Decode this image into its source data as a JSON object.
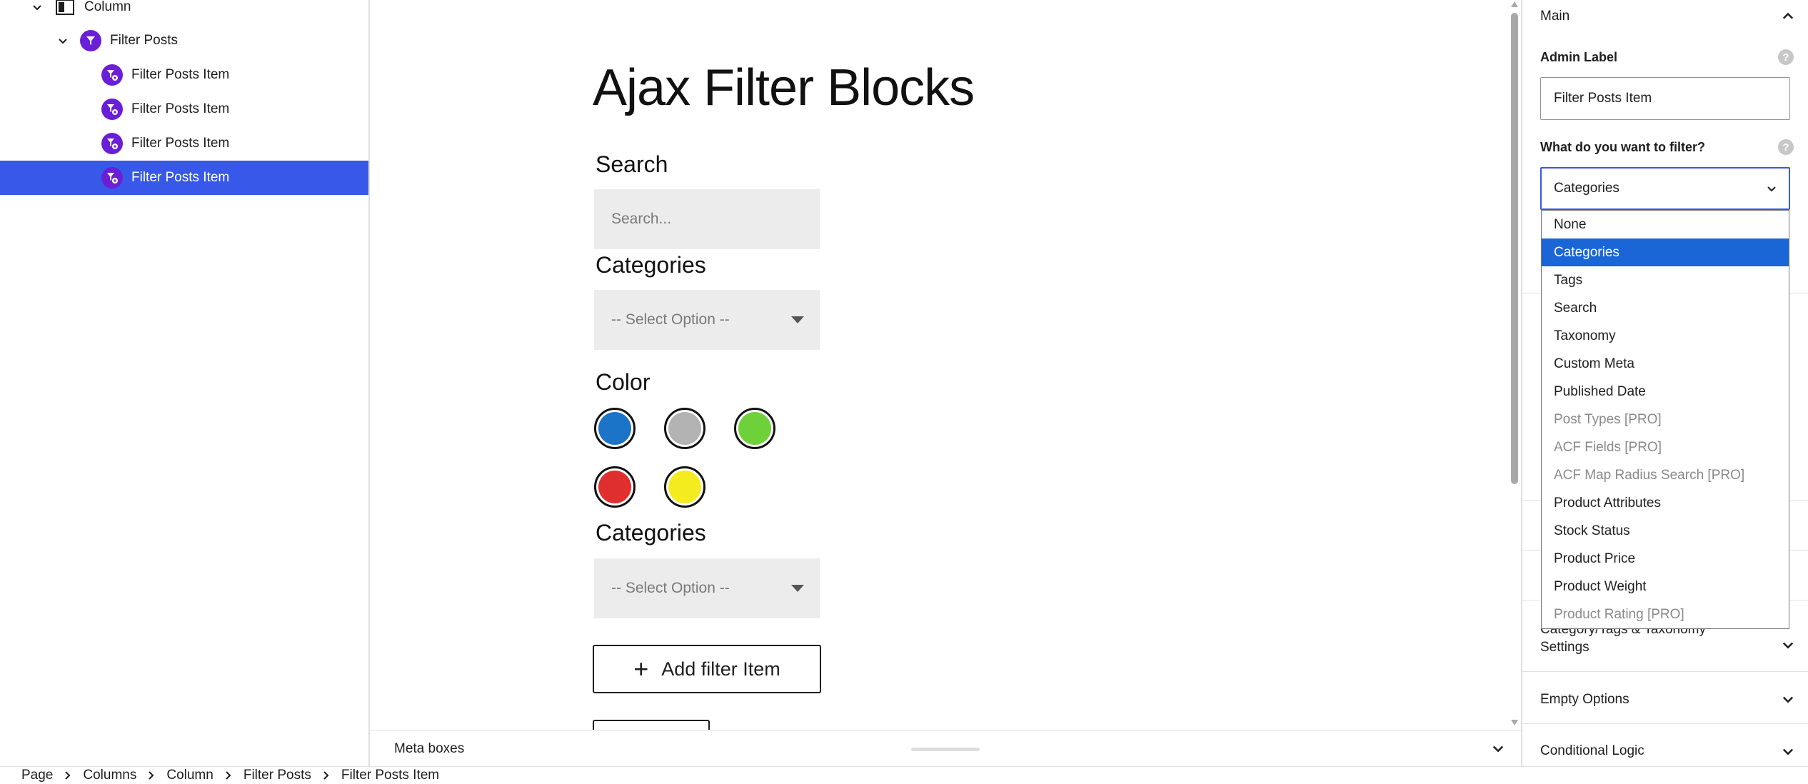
{
  "list_view": {
    "items": [
      {
        "label": "Column",
        "icon": "column-block-icon",
        "level": 1,
        "expanded": true
      },
      {
        "label": "Filter Posts",
        "icon": "filter-posts-icon",
        "level": 2,
        "expanded": true
      },
      {
        "label": "Filter Posts Item",
        "icon": "filter-posts-item-icon",
        "level": 3
      },
      {
        "label": "Filter Posts Item",
        "icon": "filter-posts-item-icon",
        "level": 3
      },
      {
        "label": "Filter Posts Item",
        "icon": "filter-posts-item-icon",
        "level": 3
      },
      {
        "label": "Filter Posts Item",
        "icon": "filter-posts-item-icon",
        "level": 3,
        "selected": true
      }
    ]
  },
  "canvas": {
    "title": "Ajax Filter Blocks",
    "search": {
      "label": "Search",
      "placeholder": "Search..."
    },
    "categories1": {
      "label": "Categories",
      "value": "-- Select Option --"
    },
    "color": {
      "label": "Color",
      "swatches": [
        "#1b74c8",
        "#b3b3b3",
        "#6fd13a",
        "#e02f2f",
        "#f4ec1e"
      ]
    },
    "categories2": {
      "label": "Categories",
      "value": "-- Select Option --"
    },
    "add_filter_label": "Add filter Item"
  },
  "meta_boxes": {
    "label": "Meta boxes"
  },
  "breadcrumb": [
    "Page",
    "Columns",
    "Column",
    "Filter Posts",
    "Filter Posts Item"
  ],
  "sidebar": {
    "main_panel_title": "Main",
    "admin_label": {
      "label": "Admin Label",
      "value": "Filter Posts Item"
    },
    "filter_type": {
      "label": "What do you want to filter?",
      "value": "Categories",
      "options": [
        {
          "label": "None"
        },
        {
          "label": "Categories",
          "active": true
        },
        {
          "label": "Tags"
        },
        {
          "label": "Search"
        },
        {
          "label": "Taxonomy"
        },
        {
          "label": "Custom Meta"
        },
        {
          "label": "Published Date"
        },
        {
          "label": "Post Types [PRO]",
          "pro": true
        },
        {
          "label": "ACF Fields [PRO]",
          "pro": true
        },
        {
          "label": "ACF Map Radius Search [PRO]",
          "pro": true
        },
        {
          "label": "Product Attributes"
        },
        {
          "label": "Stock Status"
        },
        {
          "label": "Product Price"
        },
        {
          "label": "Product Weight"
        },
        {
          "label": "Product Rating [PRO]",
          "pro": true
        }
      ]
    },
    "sections": [
      {
        "title": "Category/Tags & Taxonomy Settings"
      },
      {
        "title": "Empty Options"
      },
      {
        "title": "Conditional Logic"
      }
    ]
  },
  "colors": {
    "accent": "#3858e9",
    "option_highlight": "#1a66d6",
    "block_icon": "#6a1fd6"
  }
}
